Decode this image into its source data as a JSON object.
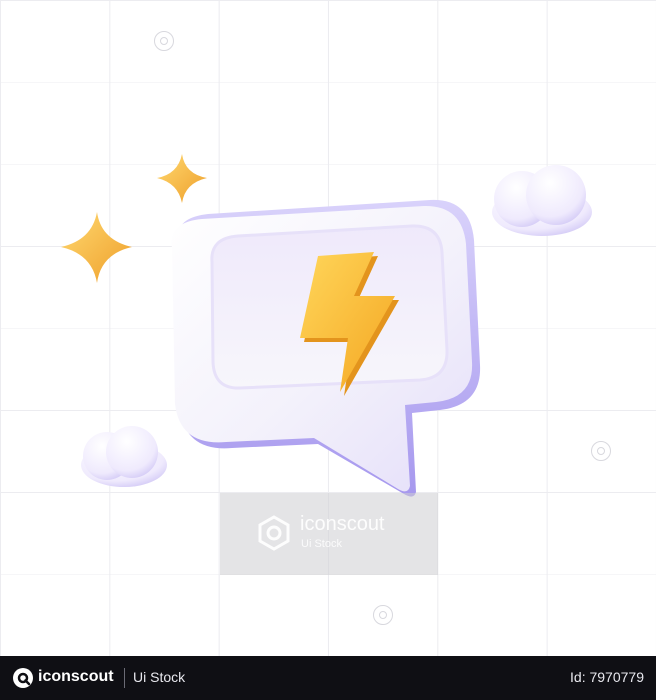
{
  "watermark": {
    "brand": "iconscout",
    "sub": "Ui Stock"
  },
  "footer": {
    "brand": "iconscout",
    "stock": "Ui Stock",
    "id_text": "Id: 7970779"
  },
  "colors": {
    "bubble": "#f4f2fb",
    "bubble_shadow": "#a79cf0",
    "bolt": "#fbc23e",
    "star": "#f7b834",
    "cloud": "#f3f0fd",
    "footer_bg": "#0f0f14"
  },
  "icons": [
    "speech-bubble-icon",
    "lightning-bolt-icon",
    "sparkle-icon",
    "cloud-icon",
    "iconscout-logo-icon"
  ]
}
